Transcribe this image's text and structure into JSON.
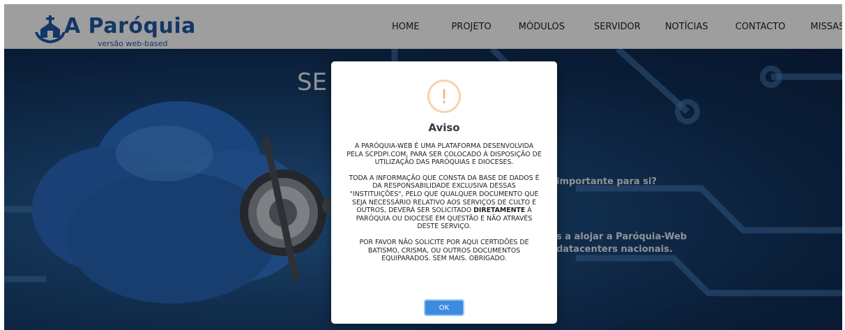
{
  "brand": {
    "title": "A Paróquia",
    "subtitle": "versão web-based",
    "color": "#1e5aa6"
  },
  "nav": {
    "items": [
      "HOME",
      "PROJETO",
      "MÓDULOS",
      "SERVIDOR",
      "NOTÍCIAS",
      "CONTACTO",
      "MISSAS"
    ]
  },
  "hero": {
    "title_fragment": "SE",
    "line1": "importante para si?",
    "line2": "s a alojar a Paróquia-Web",
    "line3": "datacenters nacionais."
  },
  "modal": {
    "icon": "warning-icon",
    "icon_glyph": "!",
    "title": "Aviso",
    "para1": "A PARÓQUIA-WEB É UMA PLATAFORMA DESENVOLVIDA PELA SCPDPI.COM, PARA SER COLOCADO À DISPOSIÇÃO DE UTILIZAÇÃO DAS PARÓQUIAS E DIOCESES.",
    "para2_before": "TODA A INFORMAÇÃO QUE CONSTA DA BASE DE DADOS É DA RESPONSABILIDADE EXCLUSIVA DESSAS \"INSTITUIÇÕES\", PELO QUE QUALQUER DOCUMENTO QUE SEJA NECESSÁRIO RELATIVO AOS SERVIÇOS DE CULTO E OUTROS, DEVERÁ SER SOLICITADO ",
    "para2_bold": "DIRETAMENTE",
    "para2_after": " À PARÓQUIA OU DIOCESE EM QUESTÃO E NÃO ATRAVÉS DESTE SERVIÇO.",
    "para3": "POR FAVOR NÃO SOLICITE POR AQUI CERTIDÕES DE BATISMO, CRISMA, OU OUTROS DOCUMENTOS EQUIPARADOS. SEM MAIS. OBRIGADO.",
    "ok_label": "OK"
  }
}
